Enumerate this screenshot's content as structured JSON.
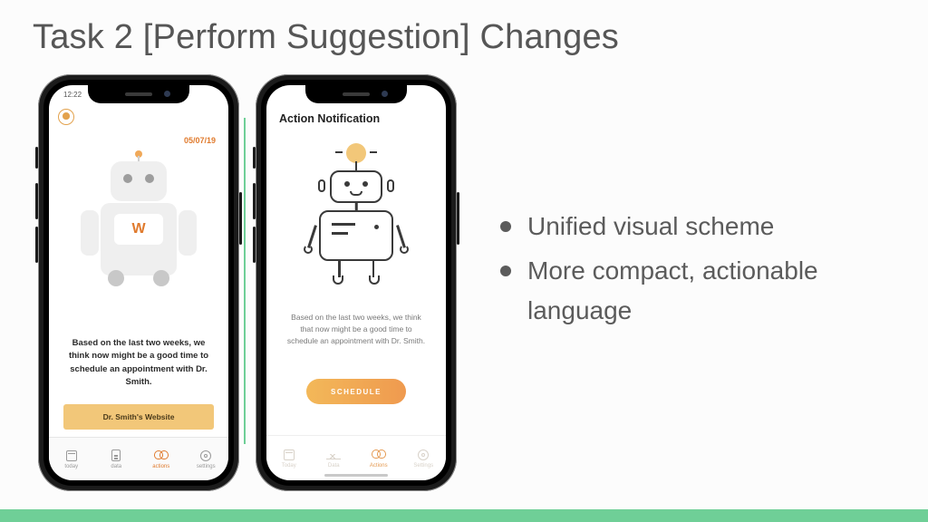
{
  "title": "Task 2 [Perform Suggestion] Changes",
  "bullets": [
    "Unified visual scheme",
    "More compact, actionable language"
  ],
  "phoneA": {
    "status_time": "12:22",
    "date": "05/07/19",
    "robot_panel": "W",
    "message": "Based on the last two weeks, we think now might be a good time to schedule an appointment with Dr. Smith.",
    "button": "Dr. Smith's Website",
    "tabs": [
      {
        "label": "today",
        "active": false
      },
      {
        "label": "data",
        "active": false
      },
      {
        "label": "actions",
        "active": true
      },
      {
        "label": "settings",
        "active": false
      }
    ]
  },
  "phoneB": {
    "header": "Action Notification",
    "message": "Based on the last two weeks, we think that now might be a good time to schedule an appointment with Dr. Smith.",
    "button": "SCHEDULE",
    "tabs": [
      {
        "label": "Today",
        "active": false
      },
      {
        "label": "Data",
        "active": false
      },
      {
        "label": "Actions",
        "active": true
      },
      {
        "label": "Settings",
        "active": false
      }
    ]
  }
}
